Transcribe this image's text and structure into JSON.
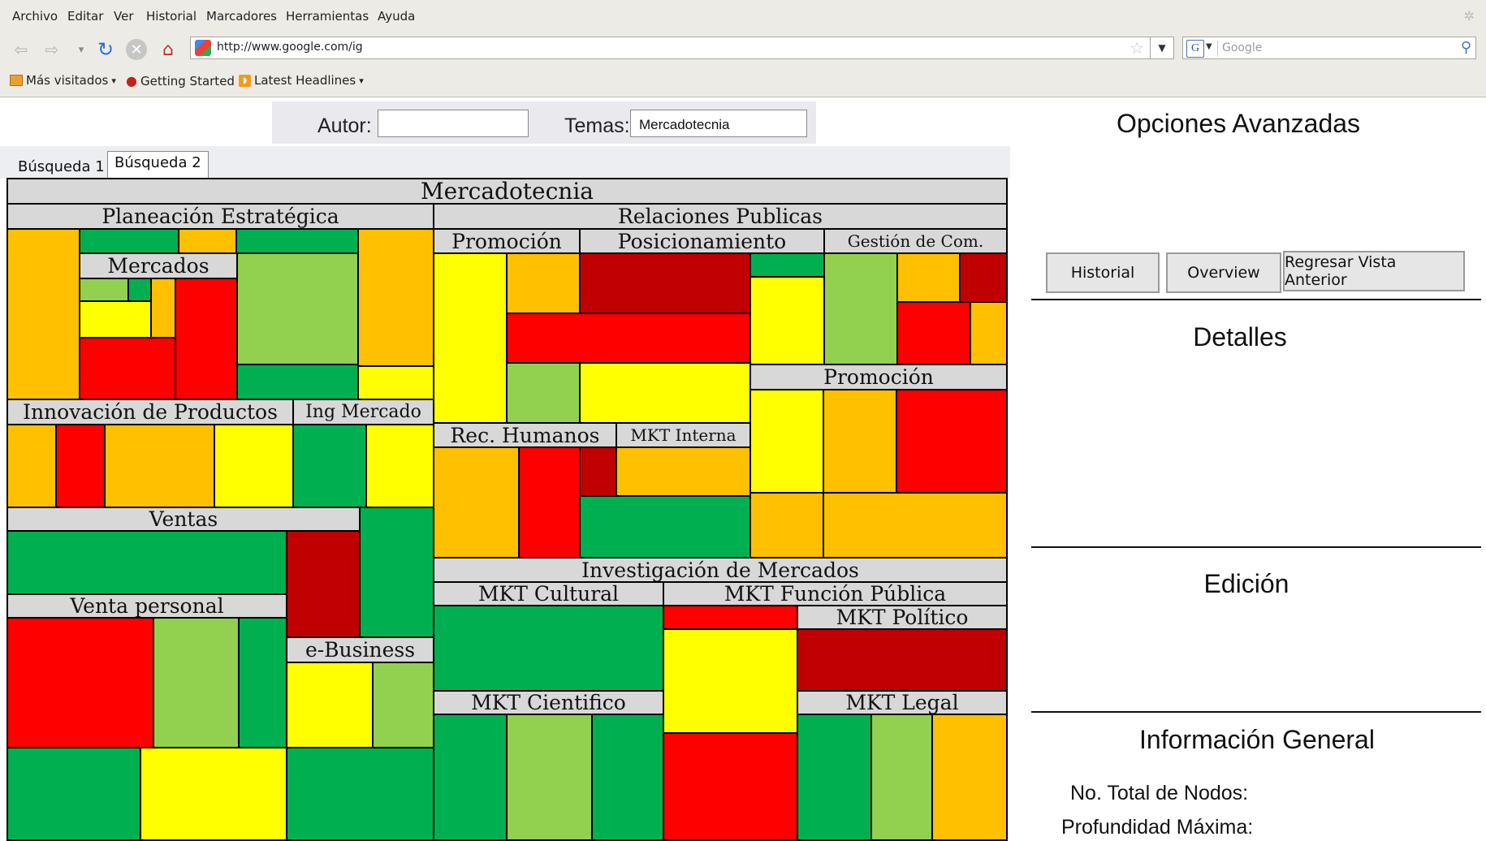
{
  "browser": {
    "menu": [
      "Archivo",
      "Editar",
      "Ver",
      "Historial",
      "Marcadores",
      "Herramientas",
      "Ayuda"
    ],
    "url": "http://www.google.com/ig",
    "search_placeholder": "Google",
    "bookmarks": [
      "Más visitados",
      "Getting Started",
      "Latest Headlines"
    ]
  },
  "criteria": {
    "autor_label": "Autor:",
    "autor_value": "",
    "temas_label": "Temas:",
    "temas_value": "Mercadotecnia"
  },
  "tabs": [
    "Búsqueda 1",
    "Búsqueda 2"
  ],
  "treemap": {
    "root": "Mercadotecnia",
    "labels": {
      "planeacion": "Planeación Estratégica",
      "mercados": "Mercados",
      "innovacion": "Innovación de Productos",
      "ing_mercado": "Ing Mercado",
      "ventas": "Ventas",
      "venta_personal": "Venta personal",
      "ebusiness": "e-Business",
      "relaciones": "Relaciones Publicas",
      "promocion1": "Promoción",
      "posicionamiento": "Posicionamiento",
      "gestion": "Gestión de Com.",
      "promocion2": "Promoción",
      "rec_humanos": "Rec. Humanos",
      "mkt_interna": "MKT Interna",
      "investigacion": "Investigación de Mercados",
      "mkt_cultural": "MKT Cultural",
      "mkt_funcion": "MKT Función Pública",
      "mkt_politico": "MKT Político",
      "mkt_cientifico": "MKT Cientifico",
      "mkt_legal": "MKT Legal"
    },
    "colors": {
      "orange": "#ffc000",
      "dark_green": "#00b050",
      "light_green": "#92d050",
      "red": "#ff0000",
      "dark_red": "#c00000",
      "yellow": "#ffff00"
    }
  },
  "right_panel": {
    "opciones": "Opciones Avanzadas",
    "buttons": [
      "Historial",
      "Overview",
      "Regresar Vista Anterior"
    ],
    "detalles": "Detalles",
    "edicion": "Edición",
    "info_general": "Información General",
    "total_nodos": "No. Total de Nodos:",
    "profundidad": "Profundidad Máxima:"
  }
}
